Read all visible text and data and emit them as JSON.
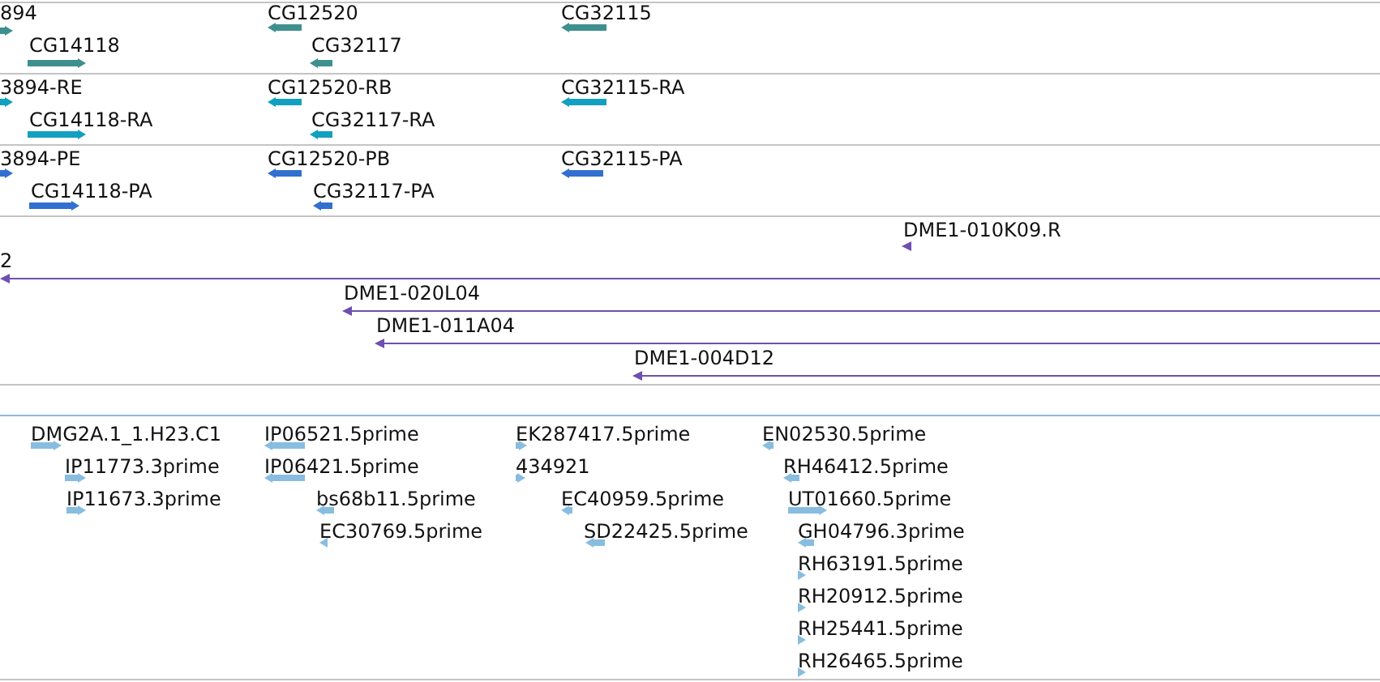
{
  "tracks": [
    {
      "kind": "block",
      "color": "#3f8f8f",
      "features": [
        {
          "label": "894",
          "reverse": false
        },
        {
          "label": "CG14118",
          "reverse": false
        },
        {
          "label": "CG12520",
          "reverse": true
        },
        {
          "label": "CG32117",
          "reverse": true
        },
        {
          "label": "CG32115",
          "reverse": true
        }
      ]
    },
    {
      "kind": "block",
      "color": "#12a0c0",
      "features": [
        {
          "label": "3894-RE",
          "reverse": false
        },
        {
          "label": "CG14118-RA",
          "reverse": false
        },
        {
          "label": "CG12520-RB",
          "reverse": true
        },
        {
          "label": "CG32117-RA",
          "reverse": true
        },
        {
          "label": "CG32115-RA",
          "reverse": true
        }
      ]
    },
    {
      "kind": "block",
      "color": "#3270d0",
      "features": [
        {
          "label": "3894-PE",
          "reverse": false
        },
        {
          "label": "CG14118-PA",
          "reverse": false
        },
        {
          "label": "CG12520-PB",
          "reverse": true
        },
        {
          "label": "CG32117-PA",
          "reverse": true
        },
        {
          "label": "CG32115-PA",
          "reverse": true
        }
      ]
    },
    {
      "kind": "line",
      "color": "#6f4fb0",
      "features": [
        {
          "label": "DME1-010K09.R",
          "reverse": true
        },
        {
          "label": "2",
          "reverse": true
        },
        {
          "label": "DME1-020L04",
          "reverse": true
        },
        {
          "label": "DME1-011A04",
          "reverse": true
        },
        {
          "label": "DME1-004D12",
          "reverse": true
        }
      ]
    },
    {
      "kind": "block",
      "color": "#88bde0",
      "features": [
        {
          "label": "DMG2A.1_1.H23.C1",
          "reverse": false
        },
        {
          "label": "IP11773.3prime",
          "reverse": false
        },
        {
          "label": "IP11673.3prime",
          "reverse": false
        },
        {
          "label": "IP06521.5prime",
          "reverse": true
        },
        {
          "label": "IP06421.5prime",
          "reverse": true
        },
        {
          "label": "bs68b11.5prime",
          "reverse": true
        },
        {
          "label": "EC30769.5prime",
          "reverse": true
        },
        {
          "label": "EK287417.5prime",
          "reverse": false
        },
        {
          "label": "434921",
          "reverse": false
        },
        {
          "label": "EC40959.5prime",
          "reverse": true
        },
        {
          "label": "SD22425.5prime",
          "reverse": true
        },
        {
          "label": "EN02530.5prime",
          "reverse": true
        },
        {
          "label": "RH46412.5prime",
          "reverse": true
        },
        {
          "label": "UT01660.5prime",
          "reverse": false
        },
        {
          "label": "GH04796.3prime",
          "reverse": true
        },
        {
          "label": "RH63191.5prime",
          "reverse": false
        },
        {
          "label": "RH20912.5prime",
          "reverse": false
        },
        {
          "label": "RH25441.5prime",
          "reverse": false
        },
        {
          "label": "RH26465.5prime",
          "reverse": false
        }
      ]
    }
  ]
}
